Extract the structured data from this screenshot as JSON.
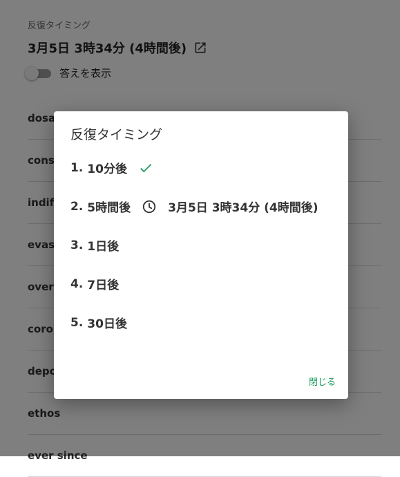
{
  "schedule": {
    "label": "反復タイミング",
    "value": "3月5日 3時34分 (4時間後)"
  },
  "toggle": {
    "label": "答えを表示",
    "checked": false
  },
  "words": [
    "dosage",
    "constant",
    "indifferent",
    "evasive",
    "overbearing",
    "coronation",
    "deposit",
    "ethos",
    "ever since"
  ],
  "dialog": {
    "title": "反復タイミング",
    "options": [
      {
        "number": "1.",
        "label": "10分後"
      },
      {
        "number": "2.",
        "label": "5時間後",
        "detail": "3月5日 3時34分 (4時間後)"
      },
      {
        "number": "3.",
        "label": "1日後"
      },
      {
        "number": "4.",
        "label": "7日後"
      },
      {
        "number": "5.",
        "label": "30日後"
      }
    ],
    "close_label": "閉じる"
  },
  "colors": {
    "accent": "#1a9a5c",
    "overlay": "rgba(0,0,0,0.5)"
  }
}
